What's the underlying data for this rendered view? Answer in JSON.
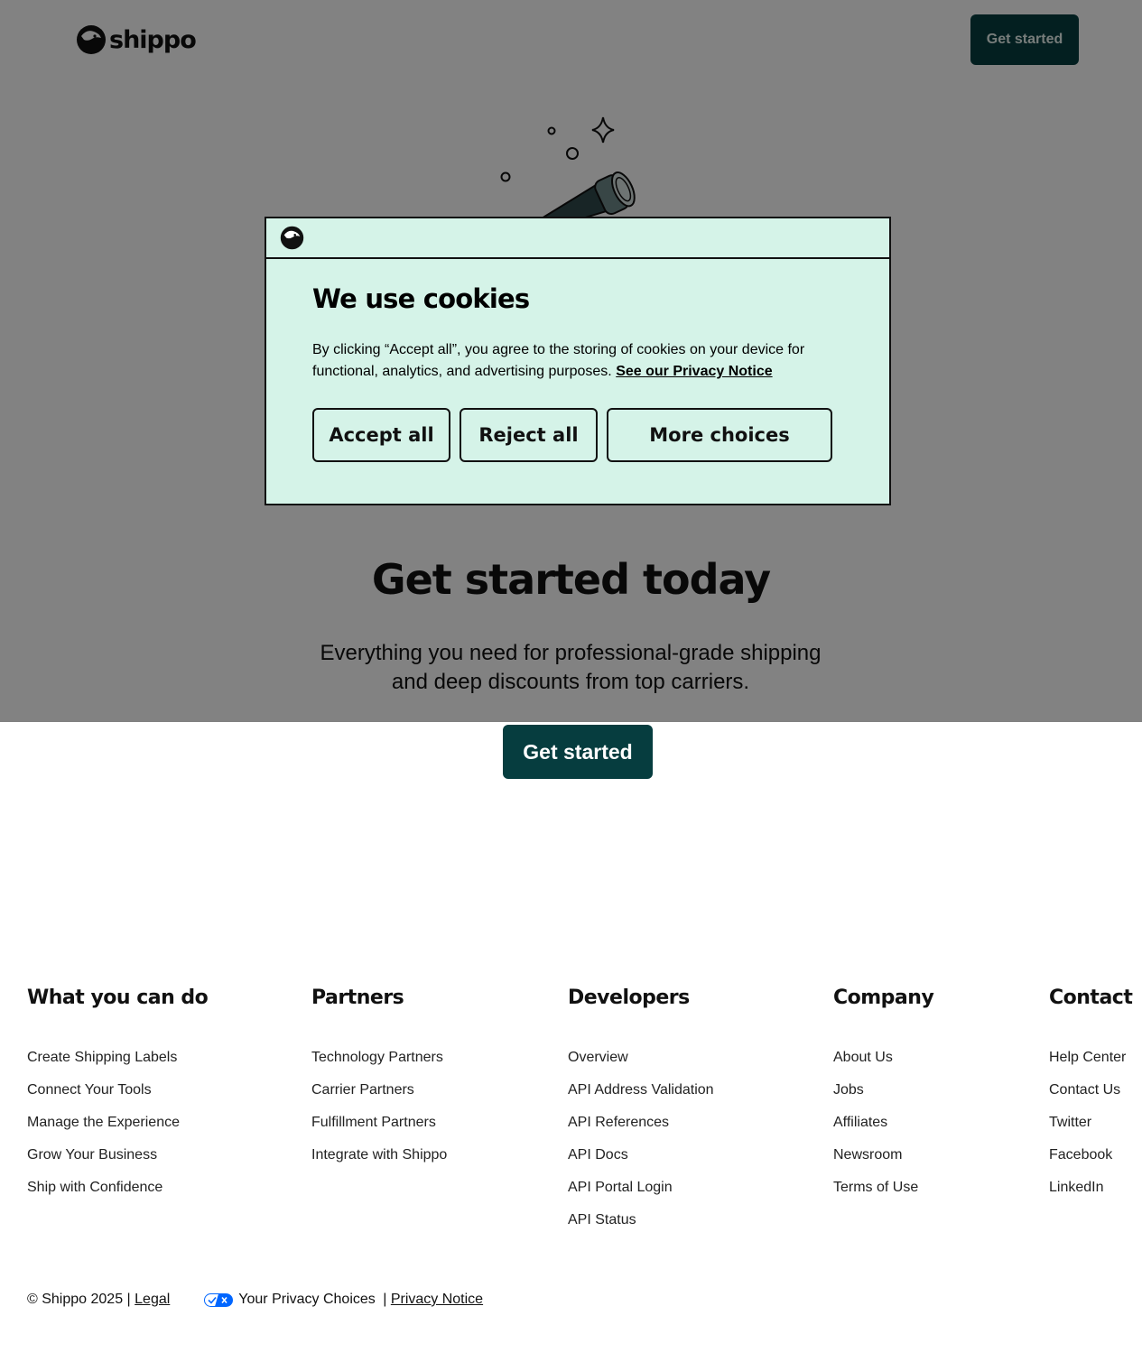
{
  "brand": {
    "name": "shippo"
  },
  "nav": {
    "cta_label": "Get started"
  },
  "hero": {
    "title": "Get started today",
    "subtitle": "Everything you need for professional-grade shipping and deep discounts from top carriers.",
    "cta_label": "Get started"
  },
  "cookie_banner": {
    "title": "We use cookies",
    "body": "By clicking “Accept all”, you agree to the storing of cookies on your device for functional, analytics, and advertising purposes.",
    "privacy_link": "See our Privacy Notice",
    "buttons": {
      "accept": "Accept all",
      "reject": "Reject all",
      "more": "More choices"
    }
  },
  "footer": {
    "columns": [
      {
        "heading": "What you can do",
        "links": [
          "Create Shipping Labels",
          "Connect Your Tools",
          "Manage the Experience",
          "Grow Your Business",
          "Ship with Confidence"
        ]
      },
      {
        "heading": "Partners",
        "links": [
          "Technology Partners",
          "Carrier Partners",
          "Fulfillment Partners",
          "Integrate with Shippo"
        ]
      },
      {
        "heading": "Developers",
        "links": [
          "Overview",
          "API Address Validation",
          "API References",
          "API Docs",
          "API Portal Login",
          "API Status"
        ]
      },
      {
        "heading": "Company",
        "links": [
          "About Us",
          "Jobs",
          "Affiliates",
          "Newsroom",
          "Terms of Use"
        ]
      },
      {
        "heading": "Contact",
        "links": [
          "Help Center",
          "Contact Us",
          "Twitter",
          "Facebook",
          "LinkedIn"
        ]
      }
    ],
    "copyright": "© Shippo 2025 | ",
    "legal_link": "Legal",
    "privacy_choices": "Your Privacy Choices",
    "separator": " | ",
    "privacy_notice_link": "Privacy Notice"
  },
  "colors": {
    "brand_dark": "#063d3f",
    "cookie_bg": "#d5f3e8",
    "overlay": "rgba(0,0,0,0.49)"
  },
  "icons": [
    "shippo-logo-icon",
    "telescope-illustration",
    "sparkle-icon",
    "privacy-toggle-icon"
  ]
}
